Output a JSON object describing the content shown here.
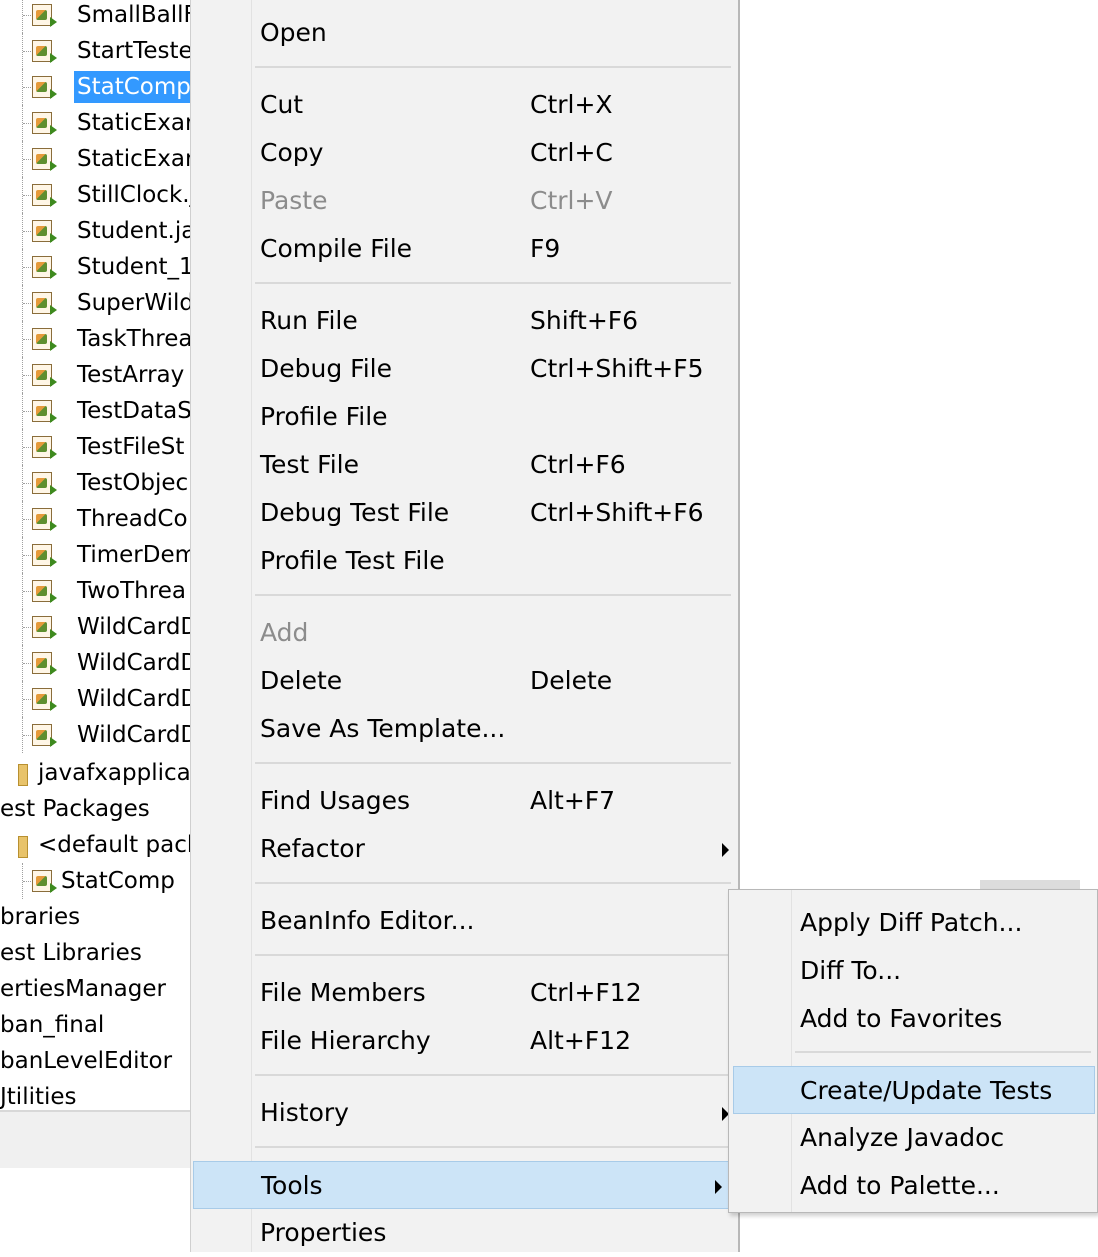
{
  "tree": {
    "files": [
      {
        "label": "SmallBallF",
        "selected": false
      },
      {
        "label": "StartTeste",
        "selected": false
      },
      {
        "label": "StatComp",
        "selected": true
      },
      {
        "label": "StaticExar",
        "selected": false
      },
      {
        "label": "StaticExar",
        "selected": false
      },
      {
        "label": "StillClock.j",
        "selected": false
      },
      {
        "label": "Student.ja",
        "selected": false
      },
      {
        "label": "Student_1",
        "selected": false
      },
      {
        "label": "SuperWild",
        "selected": false
      },
      {
        "label": "TaskThrea",
        "selected": false
      },
      {
        "label": "TestArray",
        "selected": false
      },
      {
        "label": "TestDataS",
        "selected": false
      },
      {
        "label": "TestFileSt",
        "selected": false
      },
      {
        "label": "TestObjec",
        "selected": false
      },
      {
        "label": "ThreadCo",
        "selected": false
      },
      {
        "label": "TimerDem",
        "selected": false
      },
      {
        "label": "TwoThrea",
        "selected": false
      },
      {
        "label": "WildCardD",
        "selected": false
      },
      {
        "label": "WildCardD",
        "selected": false
      },
      {
        "label": "WildCardD",
        "selected": false
      },
      {
        "label": "WildCardD",
        "selected": false
      }
    ],
    "package_javafx": "javafxapplicat",
    "test_packages": "est Packages",
    "default_package": "<default pack",
    "test_file": "StatComp",
    "libraries": "braries",
    "test_libraries": "est Libraries",
    "project_properties_manager": "ertiesManager",
    "project_ban_final": "ban_final",
    "project_ban_level_editor": "banLevelEditor",
    "project_utilities": "Jtilities"
  },
  "menu": {
    "open": "Open",
    "cut": {
      "label": "Cut",
      "shortcut": "Ctrl+X"
    },
    "copy": {
      "label": "Copy",
      "shortcut": "Ctrl+C"
    },
    "paste": {
      "label": "Paste",
      "shortcut": "Ctrl+V"
    },
    "compile": {
      "label": "Compile File",
      "shortcut": "F9"
    },
    "run": {
      "label": "Run File",
      "shortcut": "Shift+F6"
    },
    "debug": {
      "label": "Debug File",
      "shortcut": "Ctrl+Shift+F5"
    },
    "profile": {
      "label": "Profile File"
    },
    "test": {
      "label": "Test File",
      "shortcut": "Ctrl+F6"
    },
    "debug_test": {
      "label": "Debug Test File",
      "shortcut": "Ctrl+Shift+F6"
    },
    "profile_test": {
      "label": "Profile Test File"
    },
    "add": {
      "label": "Add"
    },
    "delete": {
      "label": "Delete",
      "shortcut": "Delete"
    },
    "save_template": {
      "label": "Save As Template..."
    },
    "find_usages": {
      "label": "Find Usages",
      "shortcut": "Alt+F7"
    },
    "refactor": {
      "label": "Refactor"
    },
    "beaninfo": {
      "label": "BeanInfo Editor..."
    },
    "file_members": {
      "label": "File Members",
      "shortcut": "Ctrl+F12"
    },
    "file_hierarchy": {
      "label": "File Hierarchy",
      "shortcut": "Alt+F12"
    },
    "history": {
      "label": "History"
    },
    "tools": {
      "label": "Tools"
    },
    "properties": {
      "label": "Properties"
    }
  },
  "submenu": {
    "apply_diff": "Apply Diff Patch...",
    "diff_to": "Diff To...",
    "add_favorites": "Add to Favorites",
    "create_tests": "Create/Update Tests",
    "analyze_javadoc": "Analyze Javadoc",
    "add_palette": "Add to Palette..."
  },
  "colors": {
    "selection": "#3399ff",
    "highlight": "#cce4f7",
    "menu_bg": "#f2f2f2",
    "disabled_text": "#8c8c8c"
  }
}
